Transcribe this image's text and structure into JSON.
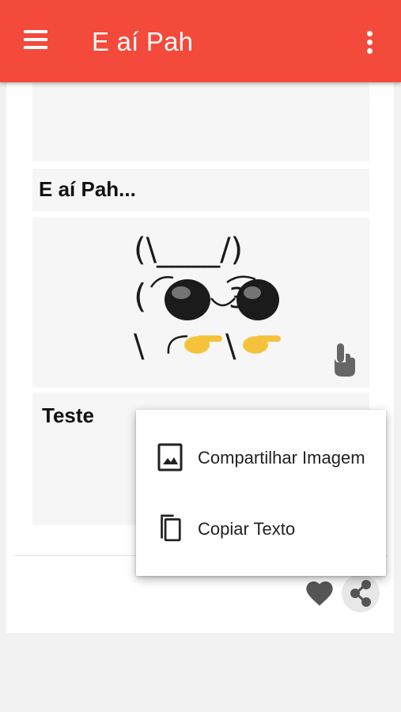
{
  "appbar": {
    "title": "E aí Pah",
    "menu_icon": "hamburger-menu-icon",
    "overflow_icon": "more-vert-icon",
    "color": "#f44a3b"
  },
  "posts": [
    {
      "caption": "E aí Pah...",
      "art_lines": [
        "(\\____/)",
        "( ●_●)",
        "\\ ╭👉\\👉"
      ]
    },
    {
      "caption": "Teste"
    }
  ],
  "actions": {
    "like_icon": "heart-icon",
    "share_icon": "share-icon",
    "touch_icon": "touch-app-icon"
  },
  "share_menu": {
    "items": [
      {
        "label": "Compartilhar Imagem",
        "icon": "image-icon"
      },
      {
        "label": "Copiar Texto",
        "icon": "copy-icon"
      }
    ]
  }
}
